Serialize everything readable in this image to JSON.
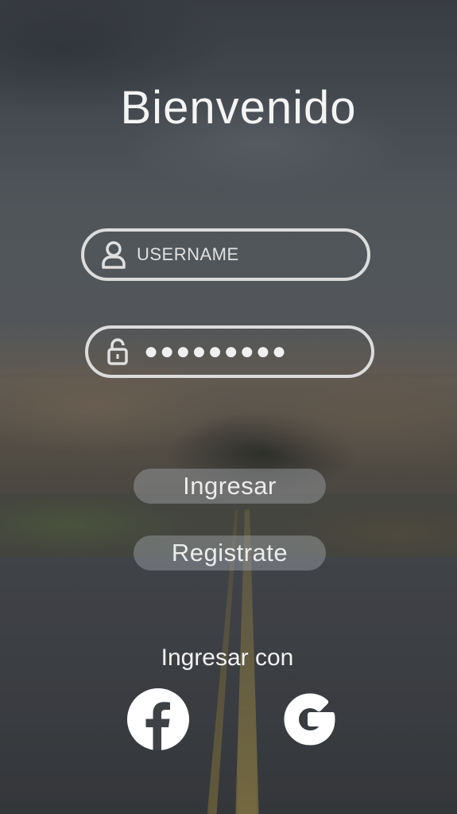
{
  "header": {
    "title": "Bienvenido"
  },
  "form": {
    "username": {
      "placeholder": "USERNAME",
      "icon": "user-icon"
    },
    "password": {
      "masked_value": "●●●●●●●●●",
      "icon": "lock-icon"
    }
  },
  "actions": {
    "login_label": "Ingresar",
    "register_label": "Registrate"
  },
  "social": {
    "label": "Ingresar con",
    "providers": [
      {
        "name": "facebook",
        "icon": "facebook-icon"
      },
      {
        "name": "google",
        "icon": "google-icon"
      }
    ]
  },
  "colors": {
    "text": "#ffffff",
    "field_border": "#dcdcdc",
    "button_fill": "#a0a4aa"
  }
}
